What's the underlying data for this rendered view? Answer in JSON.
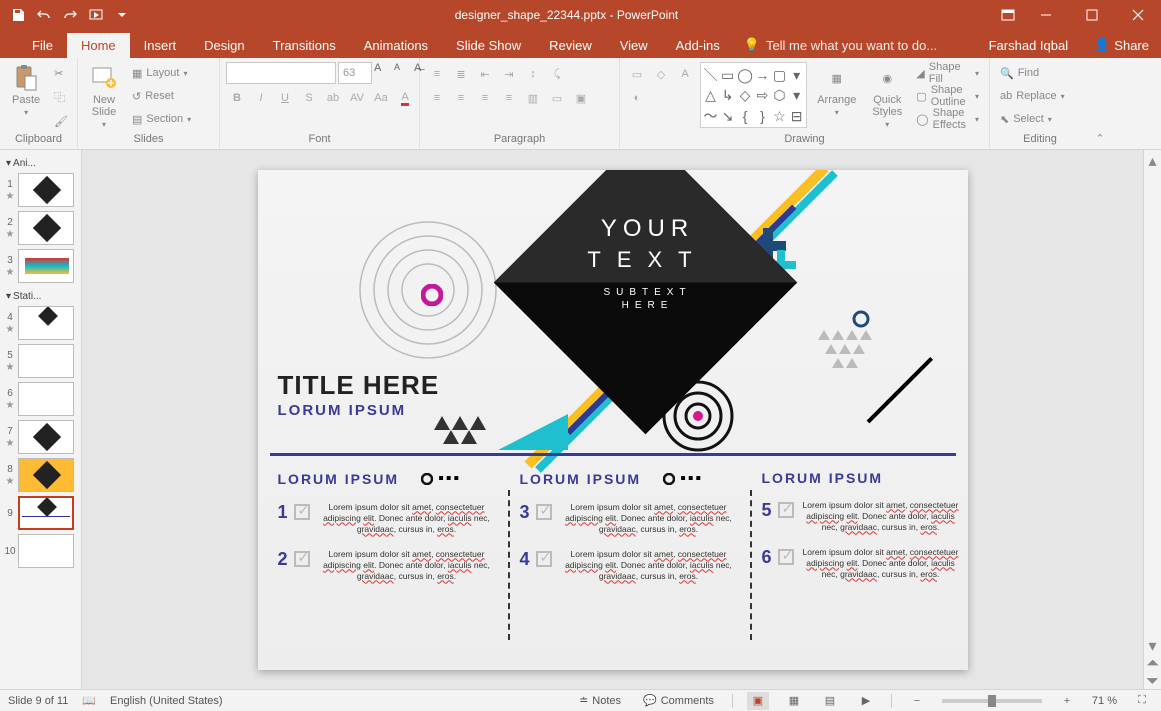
{
  "titlebar": {
    "title": "designer_shape_22344.pptx - PowerPoint"
  },
  "ribtabs": {
    "file": "File",
    "home": "Home",
    "insert": "Insert",
    "design": "Design",
    "transitions": "Transitions",
    "animations": "Animations",
    "slideshow": "Slide Show",
    "review": "Review",
    "view": "View",
    "addins": "Add-ins",
    "tellme": "Tell me what you want to do...",
    "user": "Farshad Iqbal",
    "share": "Share"
  },
  "ribbon": {
    "clipboard": {
      "label": "Clipboard",
      "paste": "Paste"
    },
    "slides": {
      "label": "Slides",
      "newslide": "New\nSlide",
      "layout": "Layout",
      "reset": "Reset",
      "section": "Section"
    },
    "font": {
      "label": "Font",
      "size": "63"
    },
    "paragraph": {
      "label": "Paragraph"
    },
    "drawing": {
      "label": "Drawing",
      "arrange": "Arrange",
      "quick": "Quick\nStyles",
      "fill": "Shape Fill",
      "outline": "Shape Outline",
      "effects": "Shape Effects"
    },
    "editing": {
      "label": "Editing",
      "find": "Find",
      "replace": "Replace",
      "select": "Select"
    }
  },
  "thumbs": {
    "section1": "Ani...",
    "section2": "Stati...",
    "items": [
      "1",
      "2",
      "3",
      "4",
      "5",
      "6",
      "7",
      "8",
      "9",
      "10"
    ]
  },
  "slide": {
    "your": "YOUR",
    "text": "TEXT",
    "sub1": "SUBTEXT",
    "sub2": "HERE",
    "title": "TITLE HERE",
    "subtitle": "LORUM IPSUM",
    "colhdr": "LORUM IPSUM",
    "body": "Lorem ipsum dolor sit amet, consectetuer adipiscing elit. Donec ante dolor, iaculis nec, gravidaac, cursus in, eros.",
    "nums": [
      "1",
      "2",
      "3",
      "4",
      "5",
      "6"
    ]
  },
  "status": {
    "slide": "Slide 9 of 11",
    "lang": "English (United States)",
    "notes": "Notes",
    "comments": "Comments",
    "zoom": "71 %"
  }
}
